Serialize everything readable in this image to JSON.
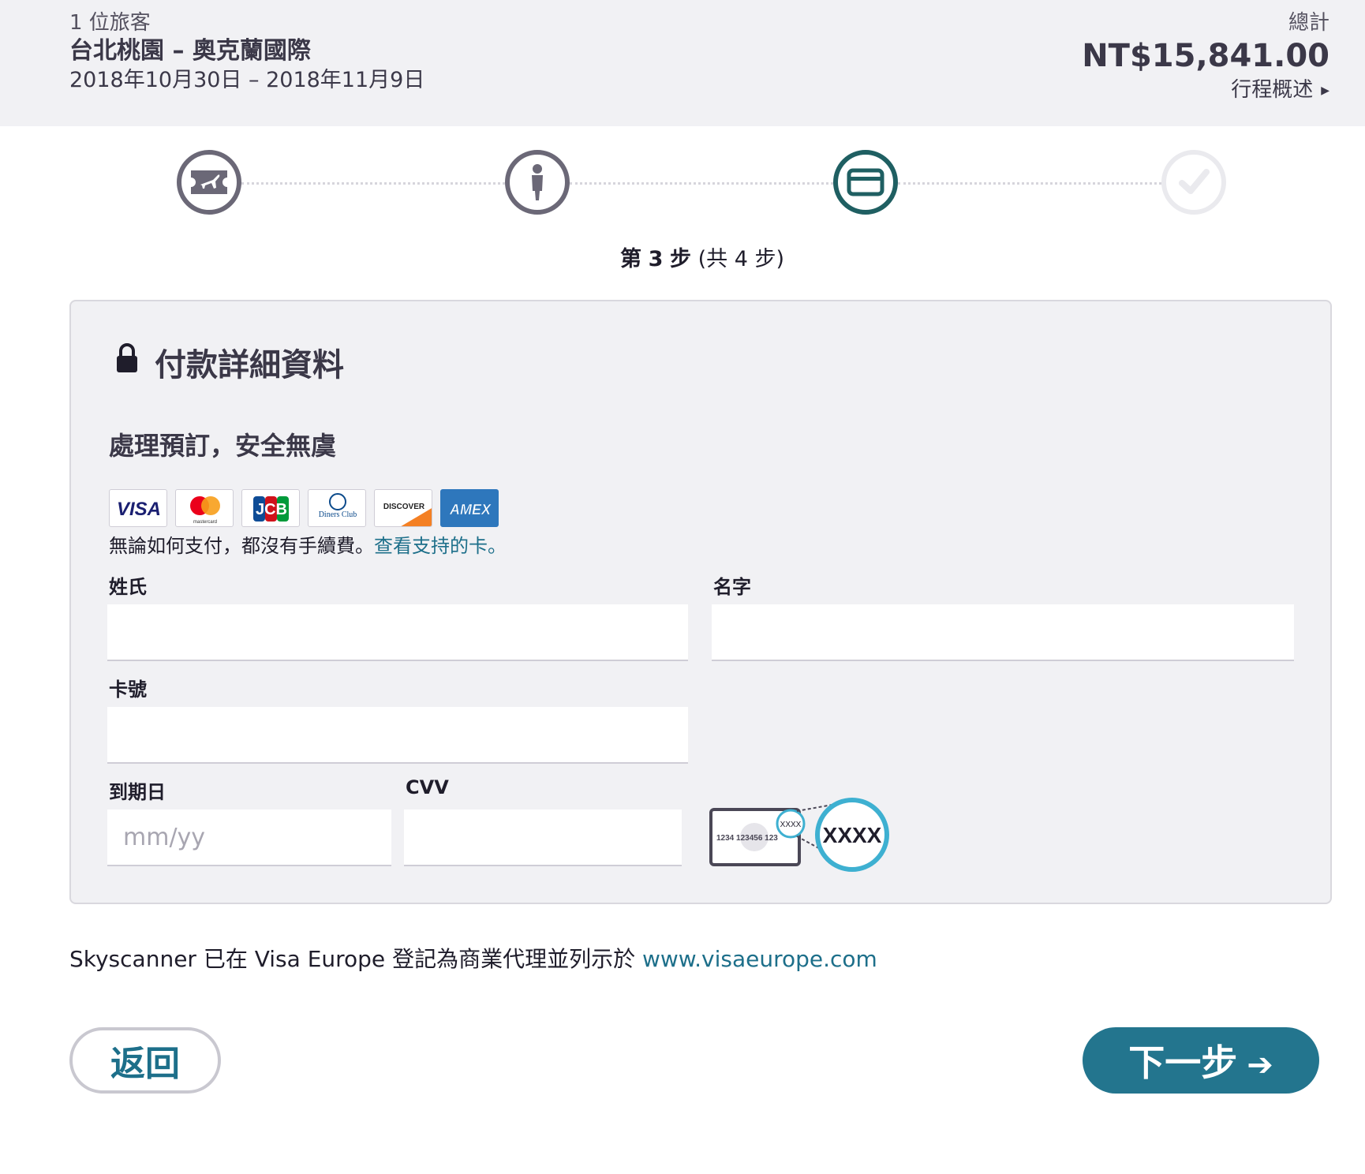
{
  "header": {
    "travellers": "1 位旅客",
    "route": "台北桃園 – 奧克蘭國際",
    "dates": "2018年10月30日 – 2018年11月9日",
    "total_label": "總計",
    "total_price": "NT$15,841.00",
    "summary_link": "行程概述"
  },
  "stepper": {
    "steps": [
      {
        "icon": "ticket-plane-icon",
        "state": "completed"
      },
      {
        "icon": "person-icon",
        "state": "completed"
      },
      {
        "icon": "credit-card-icon",
        "state": "active"
      },
      {
        "icon": "checkmark-icon",
        "state": "upcoming"
      }
    ],
    "prefix": "第",
    "current": "3",
    "step_word": "步",
    "total_text": "(共 4 步)"
  },
  "colors": {
    "accent": "#23758e",
    "active_step": "#1f5f62",
    "completed_step": "#6b6877",
    "link": "#1d6f8a",
    "cvv_highlight": "#3eb0d1"
  },
  "payment": {
    "title": "付款詳細資料",
    "secure_text": "處理預訂，安全無虞",
    "card_logos": [
      "VISA",
      "mastercard",
      "JCB",
      "Diners Club",
      "DISCOVER",
      "AMEX"
    ],
    "fees_text": "無論如何支付，都沒有手續費。",
    "fees_link": "查看支持的卡。",
    "last_name_label": "姓氏",
    "first_name_label": "名字",
    "card_number_label": "卡號",
    "expiry_label": "到期日",
    "expiry_placeholder": "mm/yy",
    "cvv_label": "CVV",
    "cvv_card_digits": "1234 123456 123",
    "cvv_small": "XXXX",
    "cvv_big": "XXXX"
  },
  "visa_note": {
    "text": "Skyscanner 已在 Visa Europe 登記為商業代理並列示於 ",
    "link": "www.visaeurope.com"
  },
  "buttons": {
    "back": "返回",
    "next": "下一步"
  }
}
